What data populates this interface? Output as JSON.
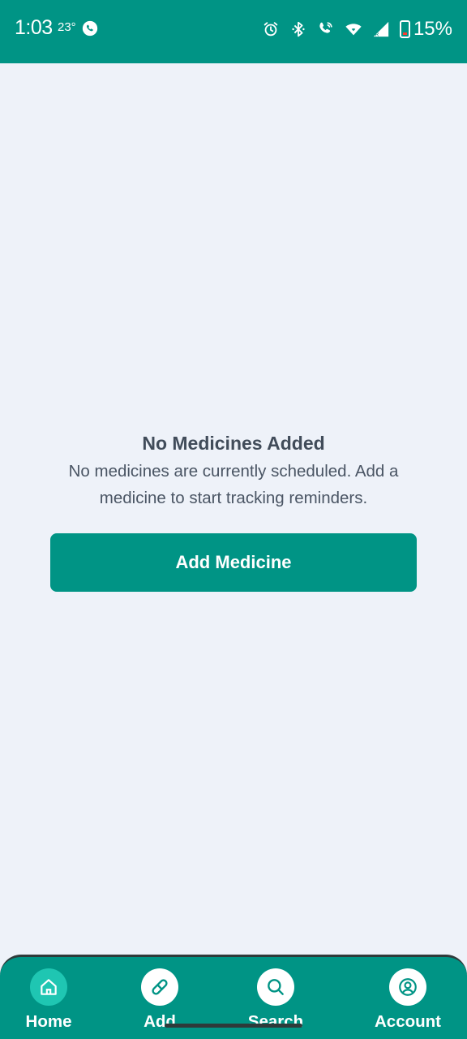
{
  "status_bar": {
    "time": "1:03",
    "temperature": "23°",
    "battery": "15%",
    "icons": [
      "whatsapp-icon",
      "alarm-icon",
      "bluetooth-icon",
      "wifi-call-icon",
      "wifi-icon",
      "signal-icon",
      "battery-icon"
    ]
  },
  "empty_state": {
    "title": "No Medicines Added",
    "message": "No medicines are currently scheduled. Add a medicine to start tracking reminders."
  },
  "add_button": {
    "label": "Add Medicine"
  },
  "bottom_nav": {
    "active": "Home",
    "items": [
      {
        "label": "Home",
        "icon": "home-icon"
      },
      {
        "label": "Add",
        "icon": "pill-icon"
      },
      {
        "label": "Search",
        "icon": "search-icon"
      },
      {
        "label": "Account",
        "icon": "account-icon"
      }
    ]
  },
  "colors": {
    "primary": "#009485",
    "active_nav": "#1FC6B2",
    "background": "#EEF2F9",
    "text_dark": "#414C5A"
  }
}
